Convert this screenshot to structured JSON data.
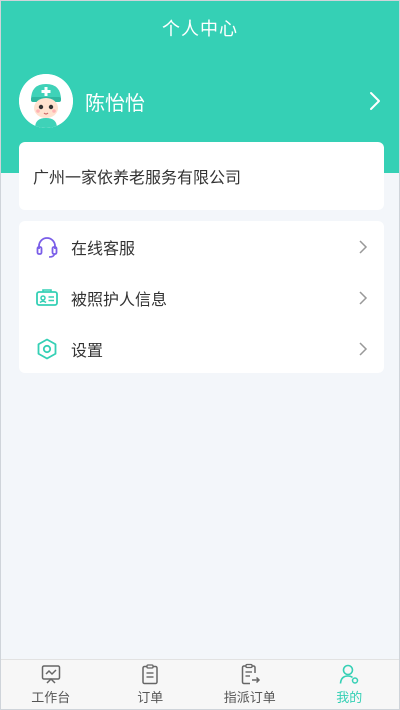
{
  "page": {
    "title": "个人中心"
  },
  "profile": {
    "name": "陈怡怡"
  },
  "company": {
    "name": "广州一家依养老服务有限公司"
  },
  "menu": {
    "items": [
      {
        "label": "在线客服",
        "icon": "headset-icon"
      },
      {
        "label": "被照护人信息",
        "icon": "id-card-icon"
      },
      {
        "label": "设置",
        "icon": "settings-hexagon-icon"
      }
    ]
  },
  "tabbar": {
    "tabs": [
      {
        "label": "工作台",
        "icon": "workbench-icon"
      },
      {
        "label": "订单",
        "icon": "clipboard-icon"
      },
      {
        "label": "指派订单",
        "icon": "assign-order-icon"
      },
      {
        "label": "我的",
        "icon": "user-icon",
        "active": true
      }
    ]
  },
  "colors": {
    "accent": "#35d0b5",
    "icon_purple": "#7a5ee8",
    "icon_teal": "#35d0b5"
  }
}
